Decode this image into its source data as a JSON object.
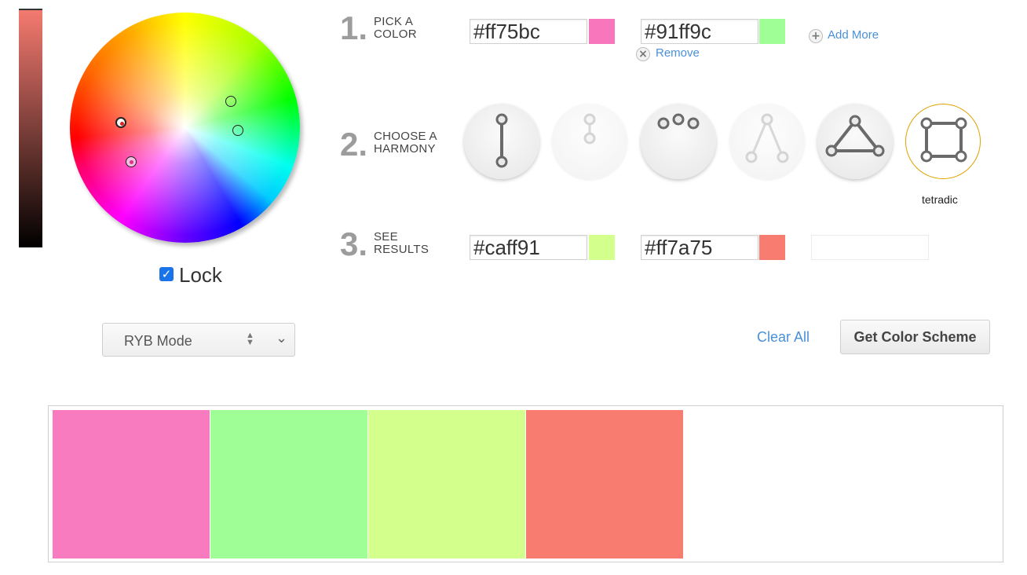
{
  "picker": {
    "lock_checked": true,
    "lock_label": "Lock",
    "mode": "RYB Mode",
    "brightness_color_top": "#f47a6f"
  },
  "steps": {
    "pick": {
      "num": "1.",
      "line1": "PICK A",
      "line2": "COLOR"
    },
    "harmony": {
      "num": "2.",
      "line1": "CHOOSE A",
      "line2": "HARMONY"
    },
    "results": {
      "num": "3.",
      "line1": "SEE",
      "line2": "RESULTS"
    }
  },
  "input_colors": [
    {
      "hex": "#ff75bc",
      "color": "#f876bc"
    },
    {
      "hex": "#91ff9c",
      "color": "#9fff96"
    }
  ],
  "links": {
    "add_more": "Add More",
    "remove": "Remove",
    "add_icon": "plus-icon",
    "remove_icon": "close-icon"
  },
  "harmonies": [
    {
      "id": "complementary",
      "state": "active",
      "icon": "complementary-icon"
    },
    {
      "id": "monochromatic",
      "state": "faded",
      "icon": "monochromatic-icon"
    },
    {
      "id": "analogous",
      "state": "active",
      "icon": "analogous-icon"
    },
    {
      "id": "split",
      "state": "faded",
      "icon": "split-complementary-icon"
    },
    {
      "id": "triadic",
      "state": "active",
      "icon": "triadic-icon"
    },
    {
      "id": "tetradic",
      "state": "selected",
      "icon": "tetradic-icon"
    }
  ],
  "selected_harmony_label": "tetradic",
  "result_colors": [
    {
      "hex": "#caff91",
      "color": "#d3ff8c"
    },
    {
      "hex": "#ff7a75",
      "color": "#f87c70"
    }
  ],
  "actions": {
    "clear_all": "Clear All",
    "get_scheme": "Get Color Scheme"
  },
  "palette": [
    "#f87abf",
    "#9fff96",
    "#d3ff8c",
    "#f87c70"
  ],
  "colors": {
    "link": "#4a90d9",
    "selected_border": "#e0a100"
  }
}
